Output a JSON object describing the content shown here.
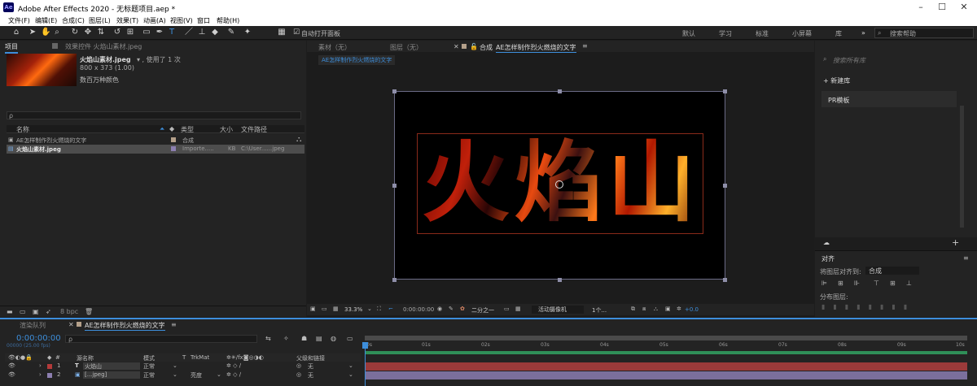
{
  "window": {
    "title": "Adobe After Effects 2020 - 无标题项目.aep *",
    "logo": "Ae"
  },
  "menu": [
    "文件(F)",
    "编辑(E)",
    "合成(C)",
    "图层(L)",
    "效果(T)",
    "动画(A)",
    "视图(V)",
    "窗口",
    "帮助(H)"
  ],
  "toolbar": {
    "auto_open": "自动打开面板",
    "workspaces": [
      "默认",
      "学习",
      "标准",
      "小屏幕",
      "库"
    ],
    "search_placeholder": "搜索帮助",
    "more": "»"
  },
  "project": {
    "tab": "项目",
    "effects_tab": "效果控件 火焰山素材.jpeg",
    "asset_name": "火焰山素材.jpeg",
    "asset_used": "▾ , 使用了 1 次",
    "asset_dims": "800 x 373 (1.00)",
    "asset_colors": "数百万种颜色",
    "search_placeholder": "ρ",
    "columns": {
      "name": "名称",
      "type": "类型",
      "size": "大小",
      "path": "文件路径"
    },
    "items": [
      {
        "name": "AE怎样制作烈火燃烧的文字",
        "type": "合成",
        "size": "",
        "path": ""
      },
      {
        "name": "火焰山素材.jpeg",
        "type": "Importe.....",
        "size": "KB",
        "path": "C:\\User......jpeg"
      }
    ],
    "bpc": "8 bpc"
  },
  "viewer": {
    "tab_footage": "素材（无）",
    "tab_layer": "图层（无）",
    "tab_comp_prefix": "合成",
    "tab_comp": "AE怎样制作烈火燃烧的文字",
    "breadcrumb": "AE怎样制作烈火燃烧的文字",
    "fire_text": "火焰山",
    "zoom": "33.3%",
    "timecode": "0:00:00:00",
    "resolution": "二分之一",
    "camera": "活动摄像机",
    "views": "1个...",
    "exposure": "+0.0"
  },
  "libraries": {
    "search_placeholder": "搜索所有库",
    "new_library": "+ 新建库",
    "item": "PR模板"
  },
  "align": {
    "title": "对齐",
    "align_to_label": "将图层对齐到:",
    "align_to_value": "合成",
    "distribute": "分布图层:"
  },
  "timeline": {
    "render_queue": "渲染队列",
    "comp_tab": "AE怎样制作烈火燃烧的文字",
    "timecode": "0:00:00:00",
    "frame_info": "00000 (25.00 fps)",
    "search_placeholder": "ρ",
    "columns": {
      "num": "#",
      "source": "源名称",
      "mode": "模式",
      "t": "T",
      "trkmat": "TrkMat",
      "parent": "父级和链接"
    },
    "layers": [
      {
        "num": "1",
        "type": "T",
        "name": "火焰山",
        "mode": "正常",
        "trkmat": "",
        "parent": "无",
        "color": "#b43a3a"
      },
      {
        "num": "2",
        "type": "▣",
        "name": "[...jpeg]",
        "mode": "正常",
        "trkmat": "亮度",
        "parent": "无",
        "color": "#8c7fb0"
      }
    ],
    "ruler": [
      "0s",
      "01s",
      "02s",
      "03s",
      "04s",
      "05s",
      "06s",
      "07s",
      "08s",
      "09s",
      "10s"
    ]
  },
  "colors": {
    "accent": "#3d8edb",
    "comp_label": "#b4a08a",
    "track1": "#9b3a3a",
    "track2": "#7b6f9c",
    "work_area": "#2f8f58"
  }
}
